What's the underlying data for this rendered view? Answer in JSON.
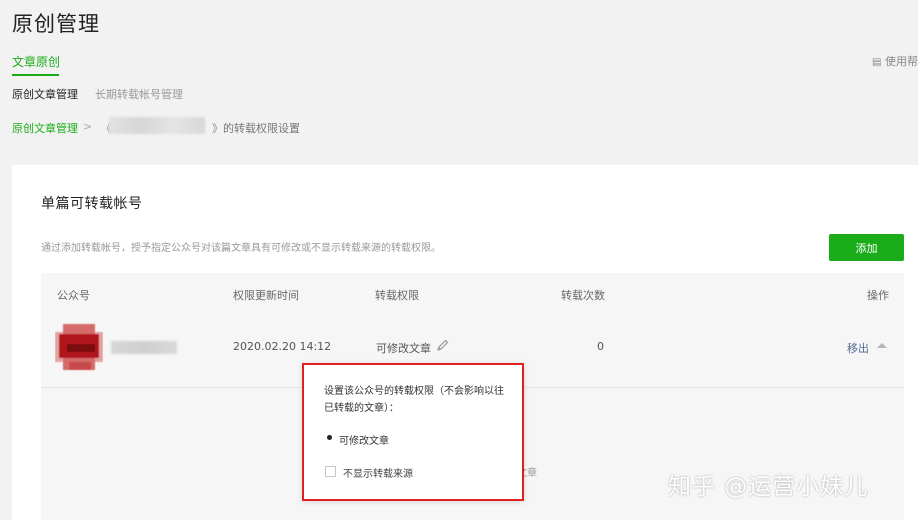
{
  "page_title": "原创管理",
  "tabs": {
    "active": "文章原创",
    "usage_link": "使用帮"
  },
  "subtabs": [
    "原创文章管理",
    "长期转载帐号管理"
  ],
  "breadcrumb": {
    "home": "原创文章管理",
    "separator": ">",
    "left_bracket": "《",
    "right_bracket": "》",
    "suffix": "的转载权限设置"
  },
  "card": {
    "title": "单篇可转载帐号",
    "description": "通过添加转载帐号，授予指定公众号对该篇文章具有可修改或不显示转载来源的转载权限。",
    "add_button": "添加"
  },
  "table": {
    "headers": [
      "公众号",
      "权限更新时间",
      "转载权限",
      "转载次数",
      "操作"
    ],
    "rows": [
      {
        "updated": "2020.02.20 14:12",
        "permission": "可修改文章",
        "count": "0",
        "action": "移出"
      }
    ]
  },
  "popover": {
    "title": "设置该公众号的转载权限（不会影响以往已转载的文章）：",
    "option_modify": "可修改文章",
    "option_hide_source": "不显示转载来源",
    "behind_text": "文章"
  },
  "watermark": "知乎 @运营小妹儿",
  "colors": {
    "accent": "#1aad19",
    "link": "#576b95",
    "highlight_border": "#e02020"
  },
  "icons": [
    "edit-pencil-icon",
    "chevron-up-icon",
    "usage-doc-icon"
  ]
}
